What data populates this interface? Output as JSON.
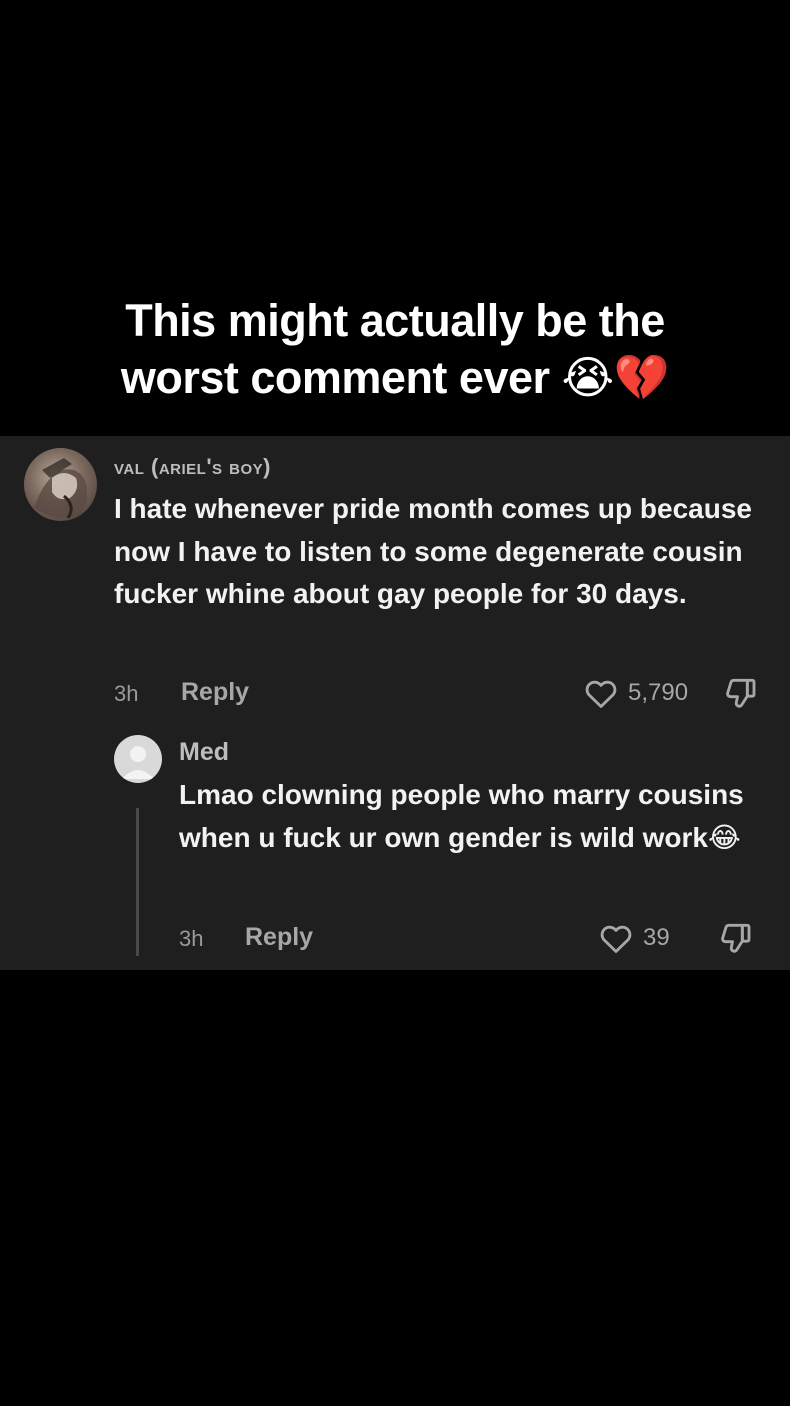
{
  "caption": {
    "line1": "This might actually be the",
    "line2": "worst comment ever 😭💔"
  },
  "comment": {
    "username": "val (ariel's boy)",
    "text": "I hate whenever pride month comes up because now I have to listen to some degenerate cousin fucker whine about gay people for 30 days.",
    "time": "3h",
    "reply_label": "Reply",
    "like_count": "5,790",
    "avatar_icon": "profile-photo"
  },
  "reply": {
    "username": "Med",
    "text": "Lmao clowning people who marry cousins when u fuck ur own gender is wild work😂",
    "time": "3h",
    "reply_label": "Reply",
    "like_count": "39",
    "avatar_icon": "default-avatar-icon"
  },
  "colors": {
    "page_background": "#000000",
    "panel_background": "#1f1f1f",
    "primary_text": "#f2f2f2",
    "secondary_text": "#a7a7a7"
  }
}
